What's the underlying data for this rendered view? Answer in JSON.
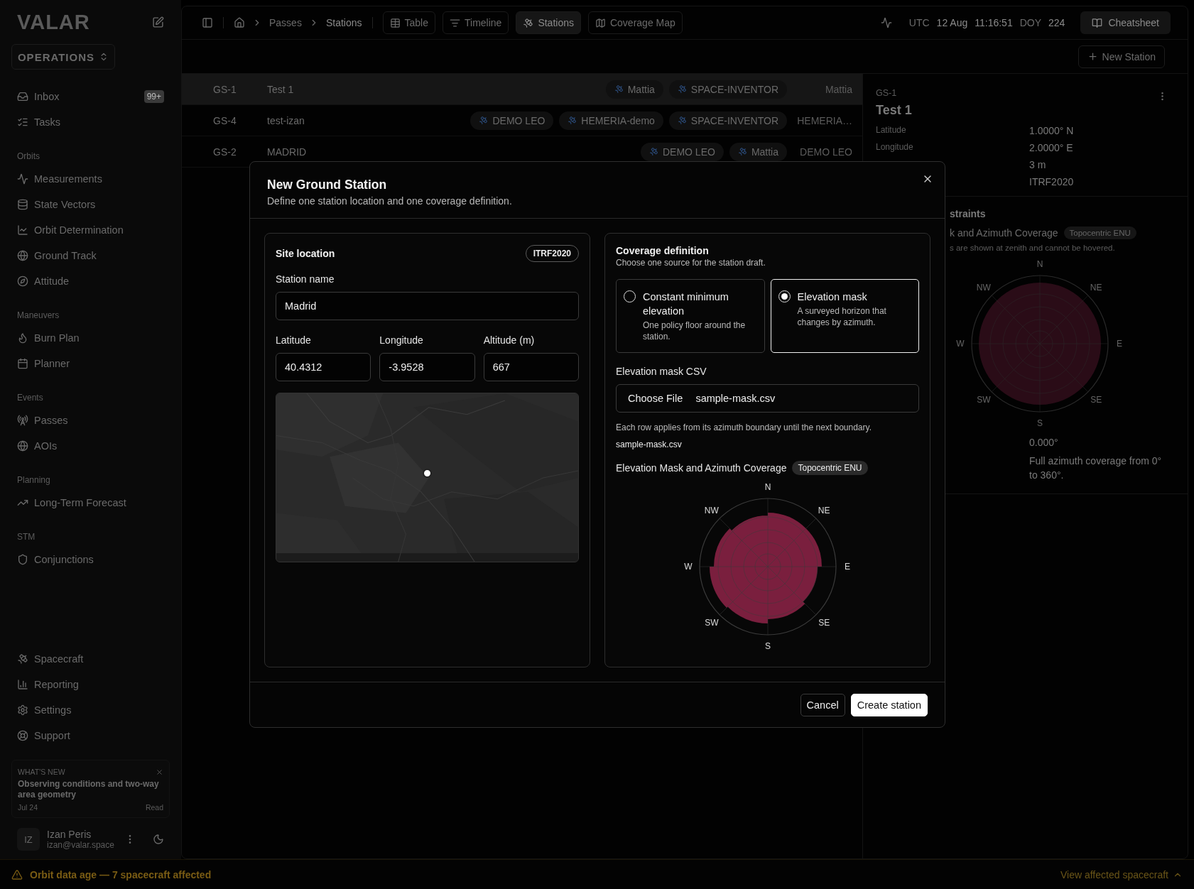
{
  "sidebar": {
    "logo": "VALAR",
    "workspace": "OPERATIONS",
    "top_items": [
      {
        "label": "Inbox",
        "badge": "99+"
      },
      {
        "label": "Tasks"
      }
    ],
    "sections": [
      {
        "title": "Orbits",
        "items": [
          {
            "label": "Measurements"
          },
          {
            "label": "State Vectors"
          },
          {
            "label": "Orbit Determination"
          },
          {
            "label": "Ground Track"
          },
          {
            "label": "Attitude"
          }
        ]
      },
      {
        "title": "Maneuvers",
        "items": [
          {
            "label": "Burn Plan"
          },
          {
            "label": "Planner"
          }
        ]
      },
      {
        "title": "Events",
        "items": [
          {
            "label": "Passes"
          },
          {
            "label": "AOIs"
          }
        ]
      },
      {
        "title": "Planning",
        "items": [
          {
            "label": "Long-Term Forecast"
          }
        ]
      },
      {
        "title": "STM",
        "items": [
          {
            "label": "Conjunctions"
          }
        ]
      }
    ],
    "footer_items": [
      {
        "label": "Spacecraft"
      },
      {
        "label": "Reporting"
      },
      {
        "label": "Settings"
      },
      {
        "label": "Support"
      }
    ],
    "whats_new": {
      "kicker": "WHAT'S NEW",
      "title": "Observing conditions and two-way area geometry",
      "date": "Jul 24",
      "action": "Read"
    },
    "user": {
      "initials": "IZ",
      "name": "Izan Peris",
      "email": "izan@valar.space"
    }
  },
  "toolbar": {
    "breadcrumbs": [
      "Passes",
      "Stations"
    ],
    "views": [
      {
        "label": "Table",
        "selected": false
      },
      {
        "label": "Timeline",
        "selected": false
      },
      {
        "label": "Stations",
        "selected": true
      },
      {
        "label": "Coverage Map",
        "selected": false
      }
    ],
    "clock": {
      "utc_label": "UTC",
      "date": "12 Aug",
      "time": "11:16:51",
      "doy_label": "DOY",
      "doy": "224"
    },
    "cheatsheet": "Cheatsheet"
  },
  "new_station_button": "New Station",
  "stations": [
    {
      "id": "GS-1",
      "name": "Test 1",
      "tags": [
        "Mattia",
        "SPACE-INVENTOR"
      ],
      "owner": "Mattia",
      "selected": true
    },
    {
      "id": "GS-4",
      "name": "test-izan",
      "tags": [
        "DEMO LEO",
        "HEMERIA-demo",
        "SPACE-INVENTOR"
      ],
      "owner": "HEMERIA…",
      "selected": false
    },
    {
      "id": "GS-2",
      "name": "MADRID",
      "tags": [
        "DEMO LEO",
        "Mattia"
      ],
      "owner": "DEMO LEO",
      "selected": false
    }
  ],
  "detail": {
    "id": "GS-1",
    "title": "Test 1",
    "fields": [
      {
        "label": "Latitude",
        "value": "1.0000° N"
      },
      {
        "label": "Longitude",
        "value": "2.0000° E"
      },
      {
        "value": "3 m"
      },
      {
        "value": "ITRF2020"
      }
    ],
    "section_fragment": "straints",
    "chart_title_fragment": "k and Azimuth Coverage",
    "chart_badge": "Topocentric ENU",
    "chart_note_fragment": "s are shown at zenith and cannot be hovered.",
    "compass": [
      "N",
      "NE",
      "E",
      "SE",
      "S",
      "SW",
      "W",
      "NW"
    ],
    "min_elevation": "0.000°",
    "coverage_note": "Full azimuth coverage from 0° to 360°."
  },
  "modal": {
    "title": "New Ground Station",
    "subtitle": "Define one station location and one coverage definition.",
    "site": {
      "title": "Site location",
      "frame": "ITRF2020",
      "name_label": "Station name",
      "name_value": "Madrid",
      "coords": [
        {
          "label": "Latitude",
          "value": "40.4312"
        },
        {
          "label": "Longitude",
          "value": "-3.9528"
        },
        {
          "label": "Altitude (m)",
          "value": "667"
        }
      ]
    },
    "coverage": {
      "title": "Coverage definition",
      "subtitle": "Choose one source for the station draft.",
      "options": [
        {
          "title": "Constant minimum elevation",
          "description": "One policy floor around the station.",
          "selected": false
        },
        {
          "title": "Elevation mask",
          "description": "A surveyed horizon that changes by azimuth.",
          "selected": true
        }
      ],
      "csv_label": "Elevation mask CSV",
      "file_button": "Choose File",
      "file_name": "sample-mask.csv",
      "help": "Each row applies from its azimuth boundary until the next boundary.",
      "selected_file": "sample-mask.csv",
      "chart_title": "Elevation Mask and Azimuth Coverage",
      "chart_badge": "Topocentric ENU",
      "compass": [
        "N",
        "NE",
        "E",
        "SE",
        "S",
        "SW",
        "W",
        "NW"
      ]
    },
    "buttons": {
      "cancel": "Cancel",
      "create": "Create station"
    }
  },
  "status_bar": {
    "message": "Orbit data age — 7 spacecraft affected",
    "action": "View affected spacecraft"
  }
}
